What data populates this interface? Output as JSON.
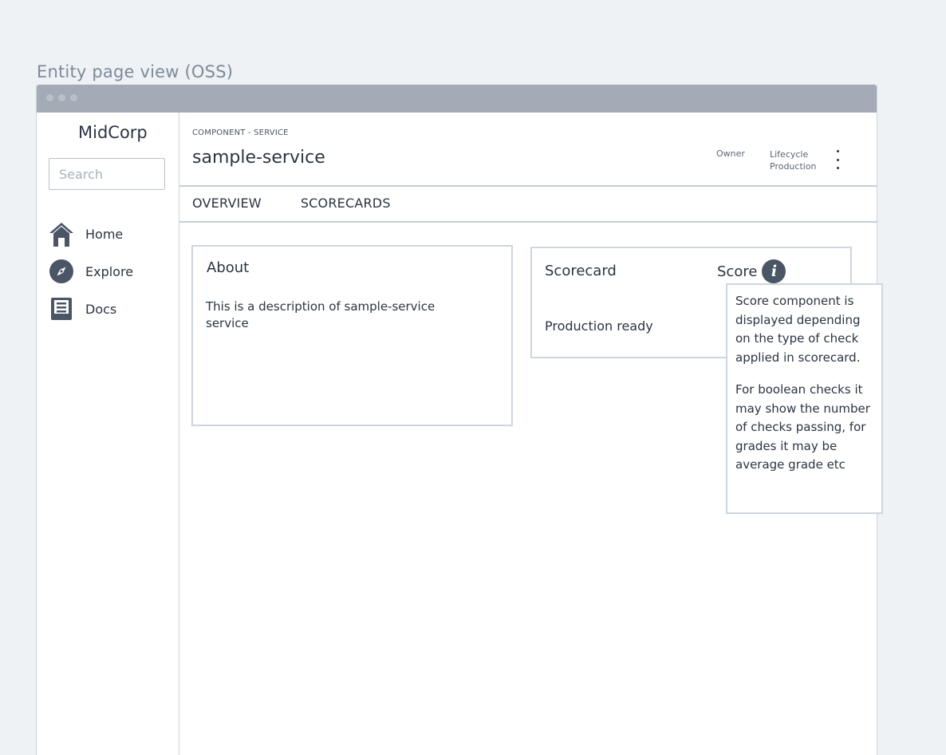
{
  "caption": "Entity page view (OSS)",
  "sidebar": {
    "brand": "MidCorp",
    "search_placeholder": "Search",
    "items": [
      {
        "label": "Home",
        "icon": "home-icon"
      },
      {
        "label": "Explore",
        "icon": "compass-icon"
      },
      {
        "label": "Docs",
        "icon": "docs-icon"
      }
    ]
  },
  "header": {
    "kind": "COMPONENT - SERVICE",
    "title": "sample-service",
    "owner_label": "Owner",
    "lifecycle_label": "Lifecycle",
    "lifecycle_value": "Production"
  },
  "tabs": [
    {
      "label": "OVERVIEW"
    },
    {
      "label": "SCORECARDS"
    }
  ],
  "about": {
    "title": "About",
    "description": "This is a description of sample-service service"
  },
  "scorecard": {
    "column_scorecard": "Scorecard",
    "column_score": "Score",
    "rows": [
      {
        "name": "Production ready"
      }
    ]
  },
  "tooltip": {
    "para1": "Score component is displayed depending on the type of check applied in scorecard.",
    "para2": "For boolean checks it may show the number of checks passing, for grades it may be average grade etc"
  },
  "colors": {
    "background": "#eff2f5",
    "titlebar": "#a3acb6",
    "border": "#cdd5de",
    "text": "#2b3442",
    "icon": "#4a5565"
  }
}
